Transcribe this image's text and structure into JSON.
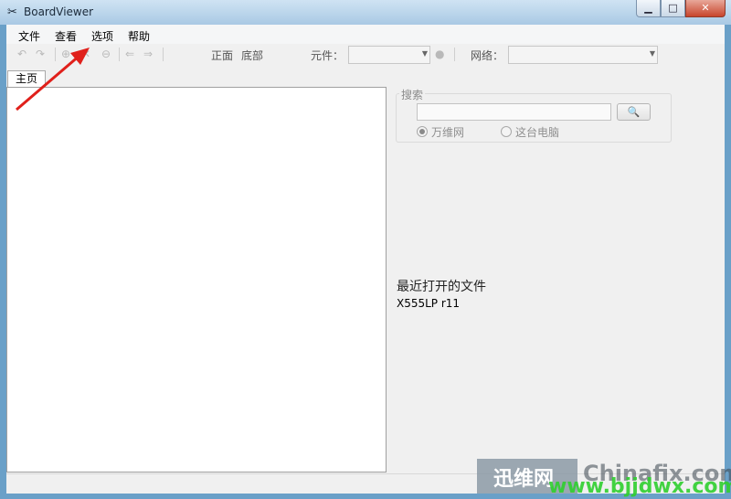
{
  "window": {
    "title": "BoardViewer",
    "icon": "board-icon"
  },
  "window_controls": {
    "minimize": "▁",
    "maximize": "□",
    "close": "✕"
  },
  "menu": {
    "file": "文件",
    "view": "查看",
    "options": "选项",
    "help": "帮助"
  },
  "toolbar": {
    "front": "正面",
    "bottom": "底部",
    "component_label": "元件：",
    "network_label": "网络："
  },
  "tabs": [
    {
      "label": "主页"
    }
  ],
  "search": {
    "group_label": "搜索",
    "input_value": "",
    "button_icon": "🔍",
    "option_web": "万维网",
    "option_local": "这台电脑"
  },
  "recent": {
    "heading": "最近打开的文件",
    "files": [
      "X555LP r11"
    ]
  },
  "watermark": {
    "text_cn": "迅维网",
    "text_site": "Chinafix.com",
    "text_url": "www.bjjdwx.com"
  },
  "colors": {
    "accent_arrow": "#e0201b",
    "titlebar": "#a9c9e4",
    "watermark_green": "#2fcf2f"
  }
}
